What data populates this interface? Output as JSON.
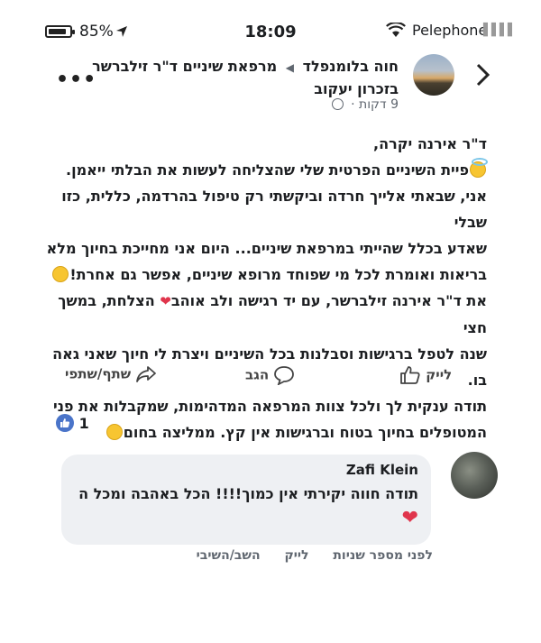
{
  "status_bar": {
    "battery_pct": "85%",
    "battery_level": 0.85,
    "time": "18:09",
    "carrier": "Pelephone"
  },
  "post": {
    "author": "חוה בלומנפלד",
    "target": "מרפאת שיניים ד\"ר זילברשר בזכרון יעקוב",
    "time": "9 דקות"
  },
  "body": {
    "l1": "ד\"ר אירנה יקרה,",
    "l2": "פיית השיניים הפרטית שלי שהצליחה לעשות את הבלתי ייאמן.",
    "l3": "אני, שבאתי אלייך חרדה וביקשתי רק טיפול בהרדמה, כללית, כזו שבלי",
    "l4": "שאדע בכלל שהייתי במרפאת שיניים... היום אני מחייכת בחיוך מלא",
    "l5": "בריאות ואומרת לכל מי שפוחד מרופא שיניים, אפשר גם אחרת!",
    "l6a": "את ד\"ר אירנה זילברשר, עם יד רגישה ולב אוהב",
    "l6b": "הצלחת, במשך חצי",
    "l7": "שנה לטפל ברגישות וסבלנות בכל השיניים ויצרת לי חיוך שאני גאה בו.",
    "l8": "תודה ענקית לך ולכל צוות המרפאה המדהימות, שמקבלות את פני",
    "l9": "המטופלים בחיוך בטוח וברגישות אין קץ. ממליצה בחום"
  },
  "actions": {
    "like": "לייק",
    "comment": "הגב",
    "share": "שתף/שתפי"
  },
  "reactions": {
    "count": "1"
  },
  "comment": {
    "name": "Zafi Klein",
    "text": "תודה חווה יקירתי אין כמוך!!!! הכל באהבה ומכל ה",
    "time": "לפני מספר שניות",
    "like": "לייק",
    "reply": "השב/השיבי"
  }
}
